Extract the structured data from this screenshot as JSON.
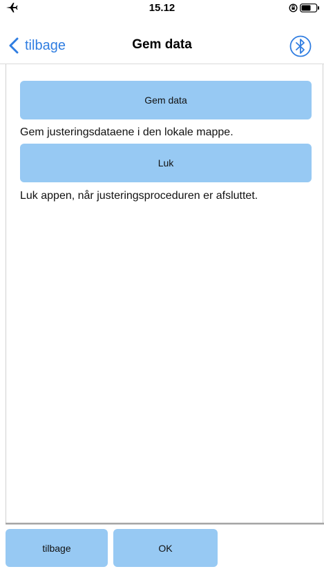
{
  "status_bar": {
    "time": "15.12",
    "airplane_icon": "airplane-icon",
    "orientation_lock_icon": "orientation-lock-icon",
    "battery_icon": "battery-icon"
  },
  "nav": {
    "back_label": "tilbage",
    "title": "Gem data",
    "bluetooth_icon": "bluetooth-icon",
    "accent_color": "#2f7de1"
  },
  "content": {
    "save_button_label": "Gem data",
    "save_description": "Gem justeringsdataene i den lokale mappe.",
    "close_button_label": "Luk",
    "close_description": "Luk appen, når justeringsproceduren er afsluttet.",
    "button_color": "#97c9f3"
  },
  "toolbar": {
    "back_label": "tilbage",
    "ok_label": "OK"
  }
}
